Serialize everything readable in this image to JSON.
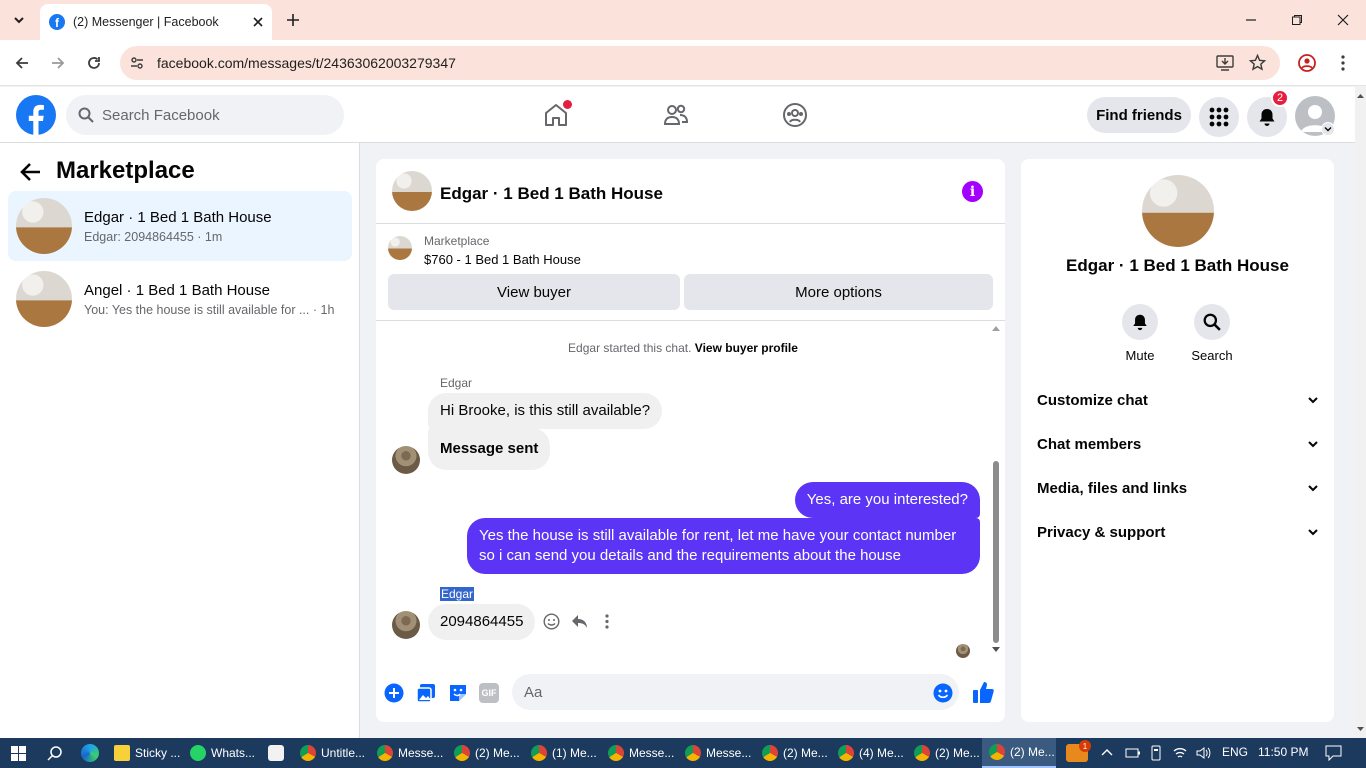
{
  "browser": {
    "tab_title": "(2) Messenger | Facebook",
    "url": "facebook.com/messages/t/24363062003279347"
  },
  "fb_header": {
    "search_placeholder": "Search Facebook",
    "find_friends": "Find friends",
    "notification_count": "2"
  },
  "sidebar": {
    "title": "Marketplace",
    "conversations": [
      {
        "name": "Edgar · 1 Bed 1 Bath House",
        "preview": "Edgar: 2094864455 · 1m",
        "selected": true
      },
      {
        "name": "Angel · 1 Bed 1 Bath House",
        "preview": "You: Yes the house is still available for ... · 1h",
        "selected": false
      }
    ]
  },
  "chat": {
    "title": "Edgar · 1 Bed 1 Bath House",
    "marketplace_label": "Marketplace",
    "listing": "$760 - 1 Bed 1 Bath House",
    "view_buyer": "View buyer",
    "more_options": "More options",
    "system_text": "Edgar started this chat.",
    "system_link": "View buyer profile",
    "sender_name": "Edgar",
    "messages": [
      {
        "from": "Edgar",
        "text": "Hi Brooke, is this still available?"
      },
      {
        "from": "Edgar",
        "text": "Message sent"
      },
      {
        "from": "me",
        "text": "Yes, are you interested?"
      },
      {
        "from": "me",
        "text": "Yes the house is still available for rent, let me have your contact number so i can send you details and the requirements about the house"
      },
      {
        "from": "Edgar",
        "text": "2094864455"
      }
    ],
    "composer_placeholder": "Aa",
    "gif_label": "GIF"
  },
  "details": {
    "name": "Edgar · 1 Bed 1 Bath House",
    "actions": [
      "Mute",
      "Search"
    ],
    "sections": [
      "Customize chat",
      "Chat members",
      "Media, files and links",
      "Privacy & support"
    ]
  },
  "taskbar": {
    "items": [
      "Sticky ...",
      "Whats...",
      "",
      "Untitle...",
      "Messe...",
      "(2) Me...",
      "(1) Me...",
      "Messe...",
      "Messe...",
      "(2) Me...",
      "(4) Me...",
      "(2) Me...",
      "(2) Me..."
    ],
    "language": "ENG",
    "time": "11:50 PM",
    "weather_badge": "1"
  },
  "colors": {
    "fb_blue": "#1877f2",
    "bubble_out": "#5b34f6",
    "accent_purple": "#a200ff",
    "tab_bar": "#fbe3db",
    "taskbar": "#1c3a5e"
  }
}
